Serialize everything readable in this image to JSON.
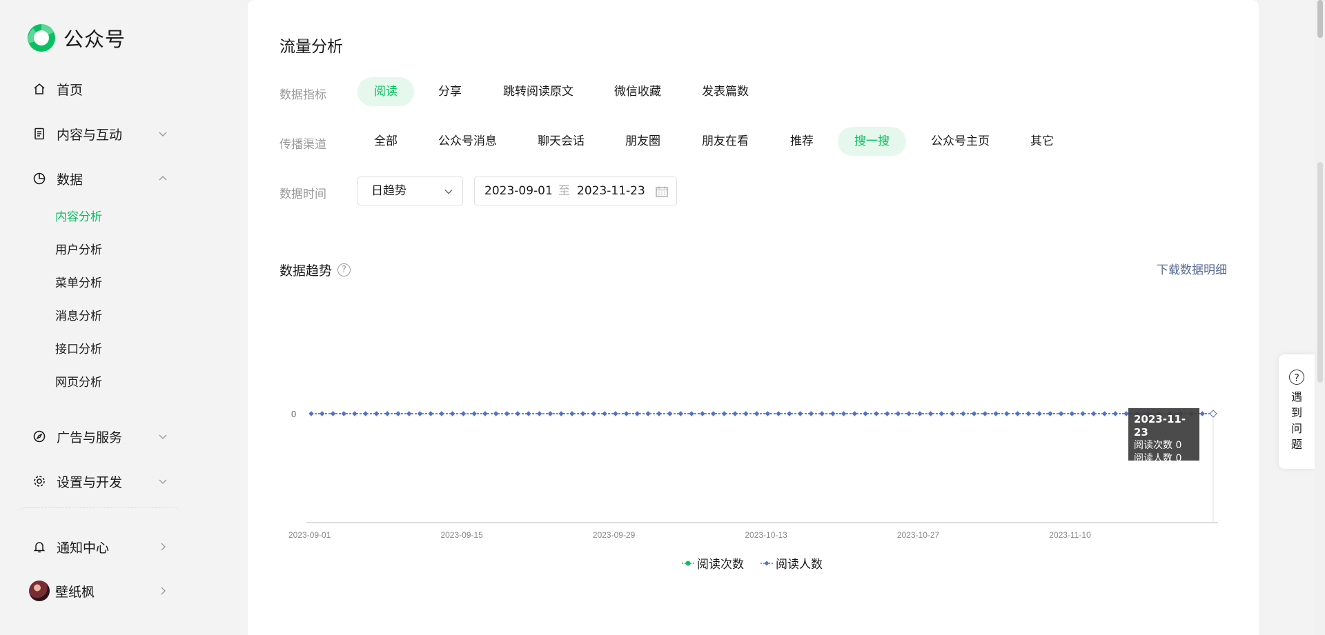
{
  "app": {
    "title": "公众号"
  },
  "sidebar": {
    "home": "首页",
    "content": "内容与互动",
    "data": "数据",
    "data_sub": [
      "内容分析",
      "用户分析",
      "菜单分析",
      "消息分析",
      "接口分析",
      "网页分析"
    ],
    "ads": "广告与服务",
    "settings": "设置与开发",
    "notify": "通知中心",
    "user_name": "壁纸枫"
  },
  "main": {
    "title": "流量分析",
    "metric_label": "数据指标",
    "metrics": [
      "阅读",
      "分享",
      "跳转阅读原文",
      "微信收藏",
      "发表篇数"
    ],
    "metric_selected": "阅读",
    "channel_label": "传播渠道",
    "channels": [
      "全部",
      "公众号消息",
      "聊天会话",
      "朋友圈",
      "朋友在看",
      "推荐",
      "搜一搜",
      "公众号主页",
      "其它"
    ],
    "channel_selected": "搜一搜",
    "time_label": "数据时间",
    "granularity": "日趋势",
    "date_start": "2023-09-01",
    "date_sep": "至",
    "date_end": "2023-11-23",
    "trend_title": "数据趋势",
    "help_mark": "?",
    "download": "下载数据明细"
  },
  "tooltip": {
    "date": "2023-11-23",
    "line1": "阅读次数 0",
    "line2": "阅读人数 0"
  },
  "help_float": {
    "mark": "?",
    "text": "遇到问题"
  },
  "colors": {
    "accent": "#07c160",
    "series1": "#07c160",
    "series2": "#5470c6",
    "link": "#576b95"
  },
  "chart_data": {
    "type": "line",
    "x": [
      "2023-09-01",
      "2023-11-23"
    ],
    "x_ticks": [
      "2023-09-01",
      "2023-09-15",
      "2023-09-29",
      "2023-10-13",
      "2023-10-27",
      "2023-11-10"
    ],
    "y_ticks": [
      "0"
    ],
    "num_days": 84,
    "series": [
      {
        "name": "阅读次数",
        "value": 0
      },
      {
        "name": "阅读人数",
        "value": 0
      }
    ],
    "legend": "bottom"
  }
}
